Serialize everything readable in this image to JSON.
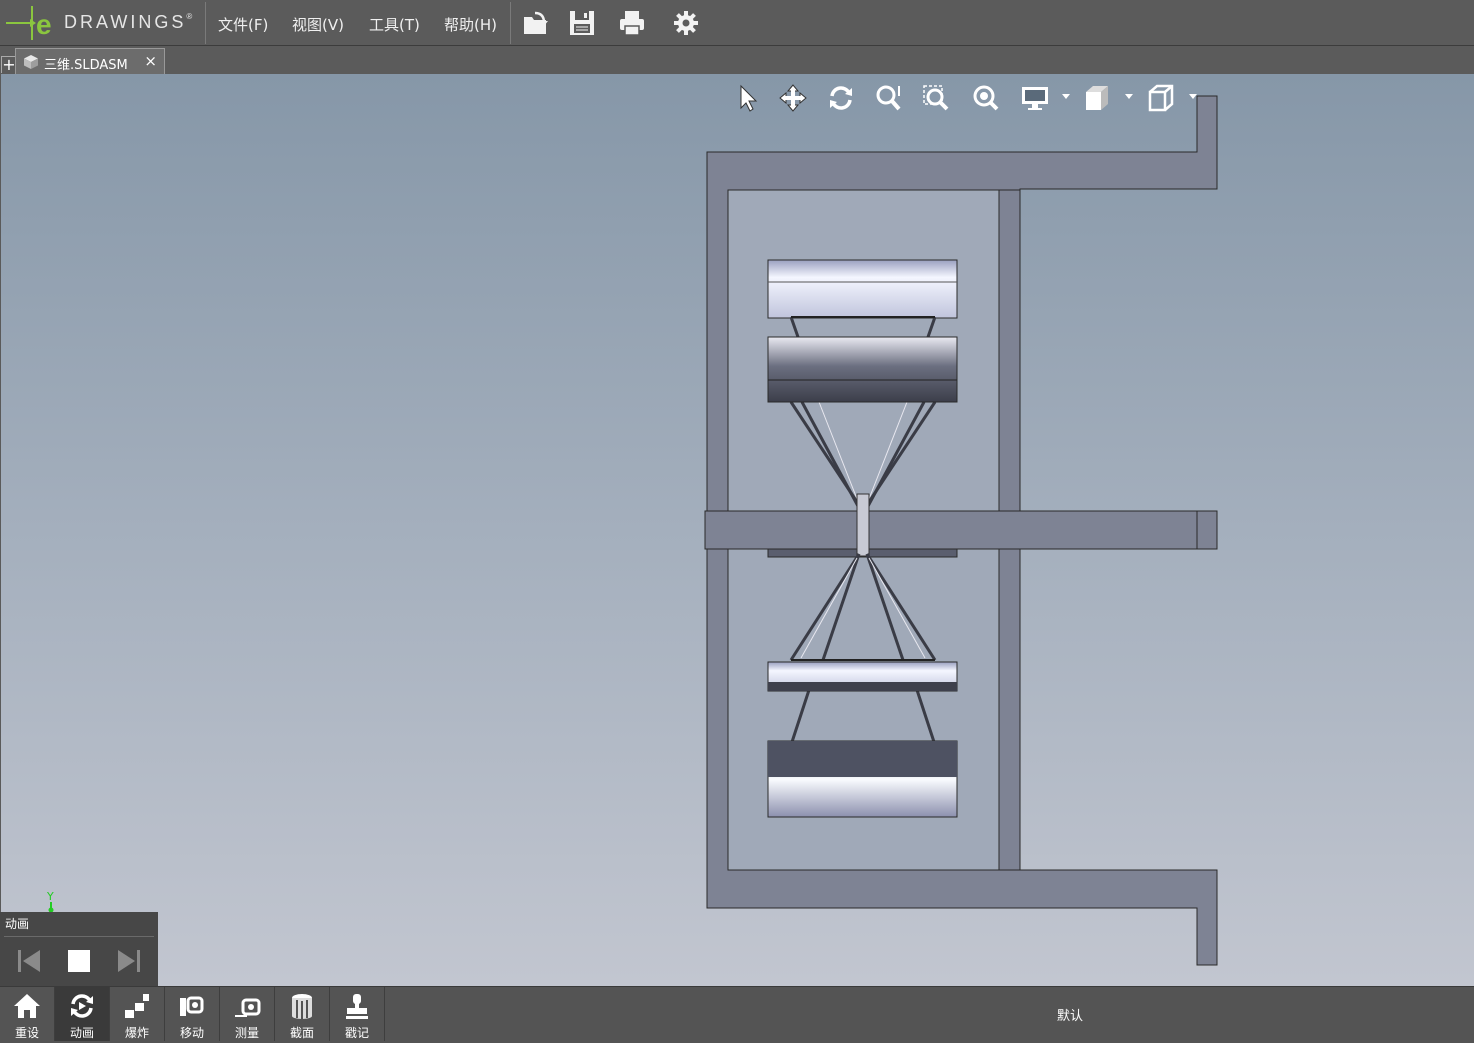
{
  "app": {
    "logo": "DRAWINGS",
    "logo_sup": "®"
  },
  "menu": {
    "file": "文件(F)",
    "view": "视图(V)",
    "tools": "工具(T)",
    "help": "帮助(H)"
  },
  "tabs": {
    "new_tab": "+",
    "document": "三维.SLDASM",
    "close": "×"
  },
  "triad": {
    "y_label": "Y"
  },
  "animation_panel": {
    "title": "动画"
  },
  "bottom_toolbar": {
    "items": [
      {
        "label": "重设",
        "icon": "home-icon"
      },
      {
        "label": "动画",
        "icon": "animate-icon"
      },
      {
        "label": "爆炸",
        "icon": "explode-icon"
      },
      {
        "label": "移动",
        "icon": "move-icon"
      },
      {
        "label": "测量",
        "icon": "measure-icon"
      },
      {
        "label": "截面",
        "icon": "section-icon"
      },
      {
        "label": "戳记",
        "icon": "stamp-icon"
      }
    ],
    "configuration": "默认"
  },
  "colors": {
    "accent_green": "#8bc63f",
    "bar_bg": "#5b5b5b",
    "frame_fill": "#7e8394"
  }
}
